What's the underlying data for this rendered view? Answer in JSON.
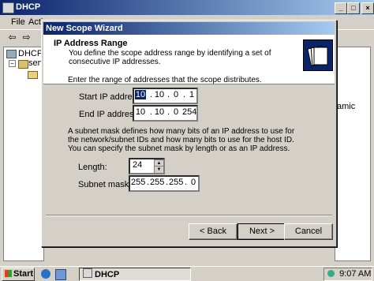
{
  "console": {
    "title": "DHCP",
    "menu": [
      "File",
      "Actio"
    ],
    "tree": [
      "DHCP",
      "serv"
    ],
    "right_text": "amic"
  },
  "wizard": {
    "title": "New Scope Wizard",
    "header_title": "IP Address Range",
    "header_desc": "You define the scope address range by identifying a set of consecutive IP addresses.",
    "intro": "Enter the range of addresses that the scope distributes.",
    "start_ip_label": "Start IP address:",
    "start_ip": [
      "10",
      "10",
      "0",
      "1"
    ],
    "end_ip_label": "End IP address:",
    "end_ip": [
      "10",
      "10",
      "0",
      "254"
    ],
    "subnet_desc": "A subnet mask defines how many bits of an IP address to use for the network/subnet IDs and how many bits to use for the host ID. You can specify the subnet mask by length or as an IP address.",
    "length_label": "Length:",
    "length_value": "24",
    "mask_label": "Subnet mask:",
    "mask": [
      "255",
      "255",
      "255",
      "0"
    ],
    "buttons": {
      "back": "< Back",
      "next": "Next >",
      "cancel": "Cancel"
    }
  },
  "taskbar": {
    "start": "Start",
    "task_label": "DHCP",
    "clock": "9:07 AM"
  }
}
